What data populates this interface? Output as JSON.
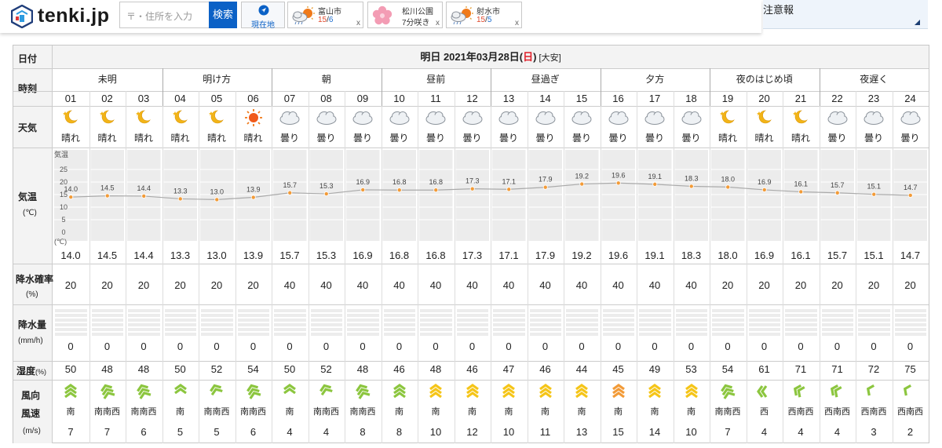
{
  "header": {
    "logo_text": "tenki.jp",
    "search_placeholder": "〒・住所を入力",
    "search_button": "検索",
    "location_button": "現在地",
    "cards": [
      {
        "name": "富山市",
        "hi": "15",
        "sep": "/",
        "lo": "6",
        "icon": "cloud-sun-icon"
      },
      {
        "name": "松川公園",
        "sub": "7分咲き",
        "icon": "sakura-icon"
      },
      {
        "name": "射水市",
        "hi": "15",
        "sep": "/",
        "lo": "5",
        "icon": "cloud-sun-icon"
      }
    ],
    "card_close": "x",
    "notice_label": "注意報"
  },
  "table": {
    "date_label": "日付",
    "date_prefix": "明日 2021年03月28日(",
    "date_weekday": "日",
    "date_suffix": ")",
    "date_rokuyo": "[大安]",
    "time_label": "時刻",
    "weather_label": "天気",
    "temp_label": "気温",
    "temp_unit": "(℃)",
    "temp_axis_title": "気温",
    "temp_axis_unit": "(℃)",
    "temp_axis_ticks": [
      "25",
      "20",
      "15",
      "10",
      "5",
      "0"
    ],
    "precip_prob_label": "降水確率",
    "precip_prob_unit": "(%)",
    "precip_label": "降水量",
    "precip_unit": "(mm/h)",
    "humidity_label": "湿度",
    "humidity_unit": "(%)",
    "wind_dir_label": "風向",
    "wind_speed_label": "風速",
    "wind_unit": "(m/s)",
    "periods": [
      "未明",
      "明け方",
      "朝",
      "昼前",
      "昼過ぎ",
      "夕方",
      "夜のはじめ頃",
      "夜遅く"
    ],
    "hours": [
      "01",
      "02",
      "03",
      "04",
      "05",
      "06",
      "07",
      "08",
      "09",
      "10",
      "11",
      "12",
      "13",
      "14",
      "15",
      "16",
      "17",
      "18",
      "19",
      "20",
      "21",
      "22",
      "23",
      "24"
    ],
    "weather": [
      "晴れ",
      "晴れ",
      "晴れ",
      "晴れ",
      "晴れ",
      "晴れ",
      "曇り",
      "曇り",
      "曇り",
      "曇り",
      "曇り",
      "曇り",
      "曇り",
      "曇り",
      "曇り",
      "曇り",
      "曇り",
      "曇り",
      "晴れ",
      "晴れ",
      "晴れ",
      "曇り",
      "曇り",
      "曇り"
    ],
    "weather_icons": [
      "moon",
      "moon",
      "moon",
      "moon",
      "moon",
      "sun",
      "cloud",
      "cloud",
      "cloud",
      "cloud",
      "cloud",
      "cloud",
      "cloud",
      "cloud",
      "cloud",
      "cloud",
      "cloud",
      "cloud",
      "moon",
      "moon",
      "moon",
      "cloud",
      "cloud",
      "cloud"
    ],
    "temps": [
      "14.0",
      "14.5",
      "14.4",
      "13.3",
      "13.0",
      "13.9",
      "15.7",
      "15.3",
      "16.9",
      "16.8",
      "16.8",
      "17.3",
      "17.1",
      "17.9",
      "19.2",
      "19.6",
      "19.1",
      "18.3",
      "18.0",
      "16.9",
      "16.1",
      "15.7",
      "15.1",
      "14.7"
    ],
    "precip_prob": [
      "20",
      "20",
      "20",
      "20",
      "20",
      "20",
      "40",
      "40",
      "40",
      "40",
      "40",
      "40",
      "40",
      "40",
      "40",
      "40",
      "40",
      "40",
      "20",
      "20",
      "20",
      "20",
      "20",
      "20"
    ],
    "precip": [
      "0",
      "0",
      "0",
      "0",
      "0",
      "0",
      "0",
      "0",
      "0",
      "0",
      "0",
      "0",
      "0",
      "0",
      "0",
      "0",
      "0",
      "0",
      "0",
      "0",
      "0",
      "0",
      "0",
      "0"
    ],
    "humidity": [
      "50",
      "48",
      "48",
      "50",
      "52",
      "54",
      "50",
      "52",
      "48",
      "46",
      "48",
      "46",
      "47",
      "46",
      "44",
      "45",
      "49",
      "53",
      "54",
      "61",
      "71",
      "71",
      "72",
      "75"
    ],
    "wind_dir": [
      "南",
      "南南西",
      "南南西",
      "南",
      "南南西",
      "南南西",
      "南",
      "南南西",
      "南南西",
      "南",
      "南",
      "南",
      "南",
      "南",
      "南",
      "南",
      "南",
      "南",
      "南南西",
      "西",
      "西南西",
      "西南西",
      "西南西",
      "西南西"
    ],
    "wind_speed": [
      "7",
      "7",
      "6",
      "5",
      "5",
      "6",
      "4",
      "4",
      "8",
      "8",
      "10",
      "12",
      "10",
      "11",
      "13",
      "15",
      "14",
      "10",
      "7",
      "4",
      "4",
      "4",
      "3",
      "2"
    ],
    "wind_colors": [
      "#8cc63f",
      "#8cc63f",
      "#8cc63f",
      "#8cc63f",
      "#8cc63f",
      "#8cc63f",
      "#8cc63f",
      "#8cc63f",
      "#8cc63f",
      "#8cc63f",
      "#f5c518",
      "#f5c518",
      "#f5c518",
      "#f5c518",
      "#f5c518",
      "#f29b38",
      "#f5c518",
      "#f5c518",
      "#8cc63f",
      "#8cc63f",
      "#8cc63f",
      "#8cc63f",
      "#8cc63f",
      "#8cc63f"
    ],
    "wind_rot": [
      0,
      -20,
      -20,
      0,
      -20,
      -20,
      0,
      -20,
      -20,
      0,
      0,
      0,
      0,
      0,
      0,
      0,
      0,
      0,
      -20,
      -90,
      -65,
      -65,
      -65,
      -65
    ]
  },
  "chart_data": {
    "type": "line",
    "x": [
      "01",
      "02",
      "03",
      "04",
      "05",
      "06",
      "07",
      "08",
      "09",
      "10",
      "11",
      "12",
      "13",
      "14",
      "15",
      "16",
      "17",
      "18",
      "19",
      "20",
      "21",
      "22",
      "23",
      "24"
    ],
    "series": [
      {
        "values": [
          14.0,
          14.5,
          14.4,
          13.3,
          13.0,
          13.9,
          15.7,
          15.3,
          16.9,
          16.8,
          16.8,
          17.3,
          17.1,
          17.9,
          19.2,
          19.6,
          19.1,
          18.3,
          18.0,
          16.9,
          16.1,
          15.7,
          15.1,
          14.7
        ]
      }
    ],
    "ylim": [
      0,
      25
    ],
    "ylabel": "気温",
    "colors": {
      "line": "#aaaaaa",
      "point": "#f29b38"
    }
  }
}
